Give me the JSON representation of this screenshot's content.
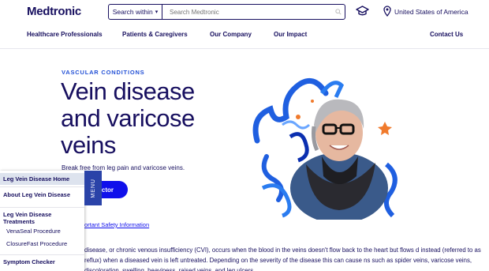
{
  "header": {
    "logo": "Medtronic",
    "search_scope": "Search within",
    "search_placeholder": "Search Medtronic",
    "region": "United States of America"
  },
  "nav": {
    "items": [
      "Healthcare Professionals",
      "Patients & Caregivers",
      "Our Company",
      "Our Impact",
      "Contact Us"
    ]
  },
  "hero": {
    "eyebrow": "VASCULAR CONDITIONS",
    "title": "Vein disease and varicose veins",
    "subtitle": "Break free from leg pain and varicose veins.",
    "cta_label": "ctor",
    "isi_link": "ortant Safety Information",
    "body": "disease, or chronic venous insufficiency (CVI), occurs when the blood in the veins doesn't flow back to the heart but flows d instead (referred to as reflux) when a diseased vein is left untreated. Depending on the severity of the disease this can cause ns such as spider veins, varicose veins, discoloration, swelling, heaviness, raised veins, and leg ulcers."
  },
  "side_menu": {
    "tab_label": "MENU",
    "items": [
      {
        "label": "Leg Vein Disease Home",
        "active": true
      },
      {
        "label": "About Leg Vein Disease"
      },
      {
        "label": "Leg Vein Disease Treatments"
      },
      {
        "label": "VenaSeal Procedure"
      },
      {
        "label": "ClosureFast Procedure"
      },
      {
        "label": "Symptom Checker"
      }
    ]
  },
  "colors": {
    "brand_navy": "#170f5f",
    "accent_blue": "#1010eb",
    "link_blue": "#2351d6",
    "menu_tab": "#2a43a8"
  }
}
